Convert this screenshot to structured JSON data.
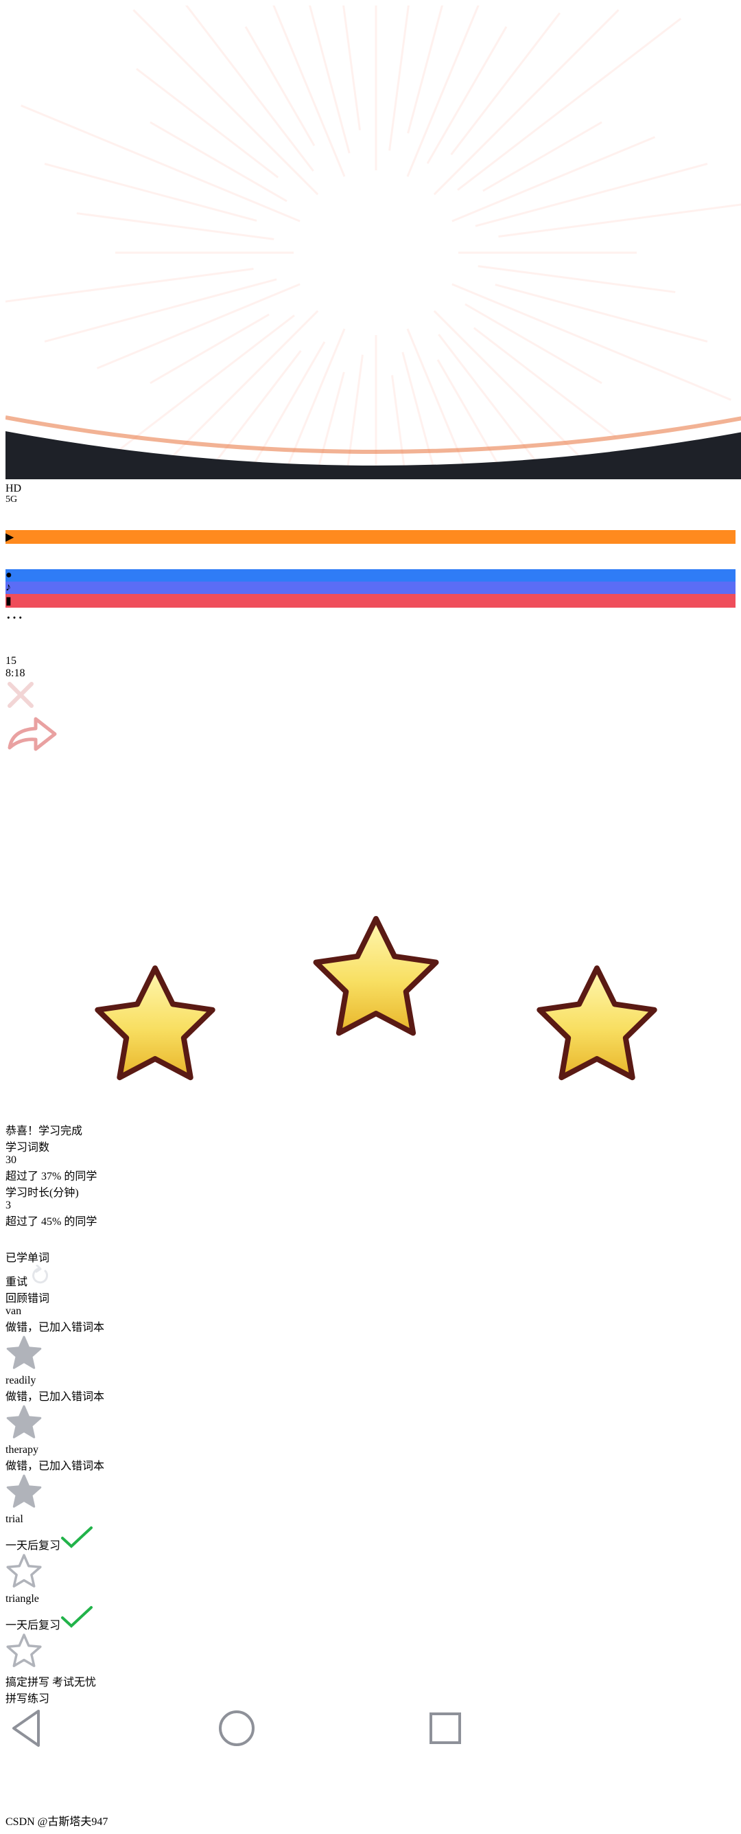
{
  "status_bar": {
    "hd": "HD",
    "network": "5G",
    "time": "8:18",
    "battery": "15"
  },
  "hero": {
    "title": "恭喜！学习完成",
    "stars_earned": 3
  },
  "stats": [
    {
      "label": "学习词数",
      "value": "30",
      "compare_prefix": "超过了",
      "percent": "37%",
      "compare_suffix": "的同学"
    },
    {
      "label": "学习时长(分钟)",
      "value": "3",
      "compare_prefix": "超过了",
      "percent": "45%",
      "compare_suffix": "的同学"
    }
  ],
  "words": {
    "header": "已学单词",
    "retry_label": "重试",
    "review_label": "回顾错词",
    "items": [
      {
        "word": "van",
        "status": "做错，已加入错词本",
        "wrong": true,
        "starred": true
      },
      {
        "word": "readily",
        "status": "做错，已加入错词本",
        "wrong": true,
        "starred": true
      },
      {
        "word": "therapy",
        "status": "做错，已加入错词本",
        "wrong": true,
        "starred": true
      },
      {
        "word": "trial",
        "status": "一天后复习",
        "wrong": false,
        "starred": false
      },
      {
        "word": "triangle",
        "status": "一天后复习",
        "wrong": false,
        "starred": false
      }
    ]
  },
  "tagline": "搞定拼写 考试无忧",
  "cta_label": "拼写练习",
  "watermark": "CSDN @古斯塔夫947",
  "colors": {
    "hero_red": "#be2a2a",
    "wrong_red": "#e8474d",
    "check_green": "#12b34a",
    "cta_green": "#5ab80d",
    "panel_bg": "#2a2e37",
    "page_bg": "#1e2128"
  }
}
